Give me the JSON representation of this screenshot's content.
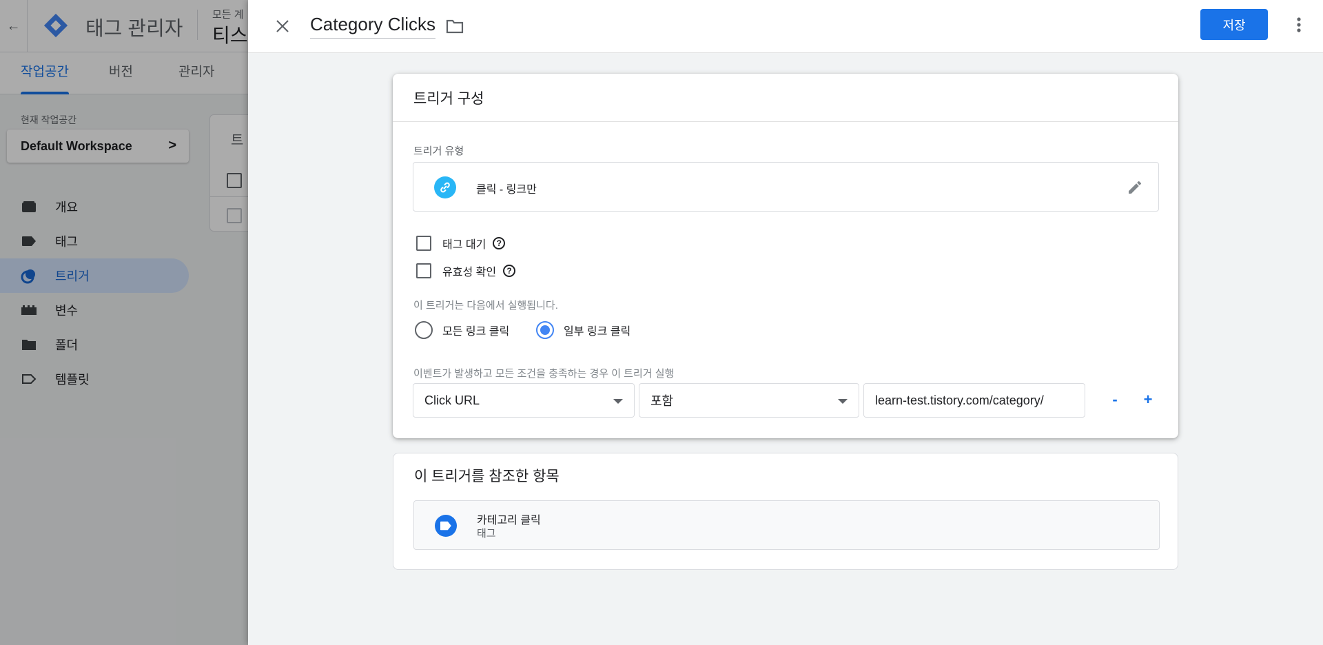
{
  "background": {
    "product_name": "태그 관리자",
    "account_small": "모든 계",
    "account_big": "티스",
    "tabs": [
      "작업공간",
      "버전",
      "관리자"
    ],
    "workspace_label": "현재 작업공간",
    "workspace_name": "Default Workspace",
    "nav": [
      "개요",
      "태그",
      "트리거",
      "변수",
      "폴더",
      "템플릿"
    ],
    "card_title": "트"
  },
  "panel": {
    "title": "Category Clicks",
    "save_label": "저장",
    "config": {
      "title": "트리거 구성",
      "trigger_type_label": "트리거 유형",
      "trigger_type": "클릭 - 링크만",
      "wait_for_tags_label": "태그 대기",
      "check_validation_label": "유효성 확인",
      "runs_on_label": "이 트리거는 다음에서 실행됩니다.",
      "radio_all": "모든 링크 클릭",
      "radio_some": "일부 링크 클릭",
      "selected_radio": "radio_some",
      "condition_label": "이벤트가 발생하고 모든 조건을 충족하는 경우 이 트리거 실행",
      "condition": {
        "variable": "Click URL",
        "operator": "포함",
        "value": "learn-test.tistory.com/category/"
      },
      "minus_label": "-",
      "plus_label": "+"
    },
    "references": {
      "title": "이 트리거를 참조한 항목",
      "items": [
        {
          "name": "카테고리 클릭",
          "type": "태그"
        }
      ]
    }
  },
  "colors": {
    "accent": "#1a73e8",
    "link_icon": "#29b6f6",
    "nav_active_bg": "#d2e3fc"
  },
  "icons": [
    "back-arrow-icon",
    "gtm-logo-icon",
    "close-icon",
    "folder-icon",
    "more-vert-icon",
    "link-icon",
    "edit-pencil-icon",
    "help-icon",
    "tag-icon"
  ]
}
